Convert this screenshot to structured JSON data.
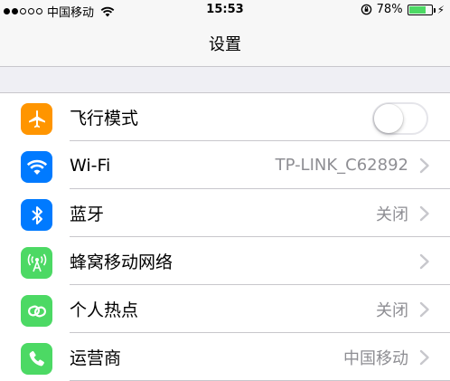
{
  "status_bar": {
    "carrier": "中国移动",
    "time": "15:53",
    "battery_percent": "78%",
    "battery_level": 0.78,
    "signal_bars_filled": 2,
    "signal_bars_total": 5
  },
  "nav": {
    "title": "设置"
  },
  "settings": [
    {
      "label": "飞行模式",
      "icon": "airplane-icon",
      "color": "#ff9500",
      "toggle": false
    },
    {
      "label": "Wi-Fi",
      "icon": "wifi-icon",
      "color": "#007aff",
      "value": "TP-LINK_C62892"
    },
    {
      "label": "蓝牙",
      "icon": "bluetooth-icon",
      "color": "#007aff",
      "value": "关闭"
    },
    {
      "label": "蜂窝移动网络",
      "icon": "cellular-icon",
      "color": "#4cd964",
      "value": ""
    },
    {
      "label": "个人热点",
      "icon": "hotspot-icon",
      "color": "#4cd964",
      "value": "关闭"
    },
    {
      "label": "运营商",
      "icon": "phone-icon",
      "color": "#4cd964",
      "value": "中国移动"
    }
  ]
}
